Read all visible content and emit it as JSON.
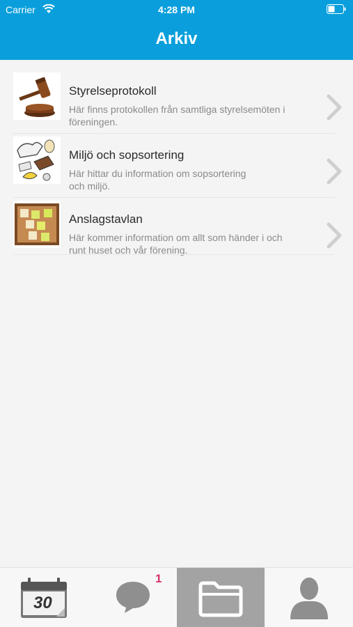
{
  "status_bar": {
    "carrier": "Carrier",
    "time": "4:28 PM"
  },
  "nav": {
    "title": "Arkiv"
  },
  "items": [
    {
      "title": "Styrelseprotokoll",
      "desc1": "Här finns protokollen från samtliga styrelsemöten i",
      "desc2": "föreningen.",
      "icon": "gavel-icon"
    },
    {
      "title": "Miljö och sopsortering",
      "desc1": "Här hittar du information om sopsortering",
      "desc2": "och miljö.",
      "icon": "garbage-icon"
    },
    {
      "title": "Anslagstavlan",
      "desc1": "Här kommer information om allt som händer i och",
      "desc2": "runt huset och vår förening.",
      "icon": "bulletin-board-icon"
    }
  ],
  "tabbar": {
    "calendar_day": "30",
    "chat_badge": "1",
    "tabs": [
      {
        "icon": "calendar-icon",
        "active": false
      },
      {
        "icon": "chat-icon",
        "active": false
      },
      {
        "icon": "folder-icon",
        "active": true
      },
      {
        "icon": "person-icon",
        "active": false
      }
    ]
  },
  "colors": {
    "header": "#0a9fdc",
    "badge": "#d6336c",
    "active_tab": "#a3a3a3"
  }
}
